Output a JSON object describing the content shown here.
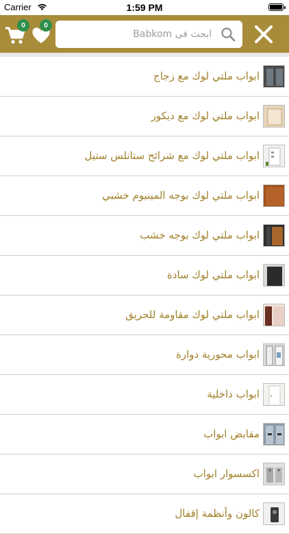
{
  "status_bar": {
    "carrier": "Carrier",
    "time": "1:59 PM"
  },
  "header": {
    "cart_count": "0",
    "wishlist_count": "0",
    "search_placeholder": "ابحث فى Babkom",
    "brand_color": "#a98c39",
    "badge_color": "#2f8f4c",
    "icons": [
      "cart-icon",
      "heart-icon",
      "search-icon",
      "close-icon"
    ]
  },
  "categories": [
    {
      "label": "ابواب ملتي لوك مع زجاج",
      "thumb_color": "#4a4a4a"
    },
    {
      "label": "ابواب ملتي لوك مع ديكور",
      "thumb_color": "#e6d3b8"
    },
    {
      "label": "ابواب ملتي لوك مع شرائح ستانلس ستيل",
      "thumb_color": "#f1f1f1"
    },
    {
      "label": "ابواب ملتي لوك بوجه المينيوم خشبي",
      "thumb_color": "#a0521d"
    },
    {
      "label": "ابواب ملتي لوك بوجه خشب",
      "thumb_color": "#8a5a2b"
    },
    {
      "label": "ابواب ملتي لوك سادة",
      "thumb_color": "#2b2b2b"
    },
    {
      "label": "ابواب ملتي لوك مقاومة للحريق",
      "thumb_color": "#c98f7a"
    },
    {
      "label": "ابواب محورية دوارة",
      "thumb_color": "#dcdcdc"
    },
    {
      "label": "ابواب داخلية",
      "thumb_color": "#f4f2ee"
    },
    {
      "label": "مقابض ابواب",
      "thumb_color": "#8b9aa8"
    },
    {
      "label": "اكسسوار ابواب",
      "thumb_color": "#c9c9c9"
    },
    {
      "label": "كالون وأنظمة إقفال",
      "thumb_color": "#3a3a3a"
    }
  ],
  "text_color": "#a0802a"
}
